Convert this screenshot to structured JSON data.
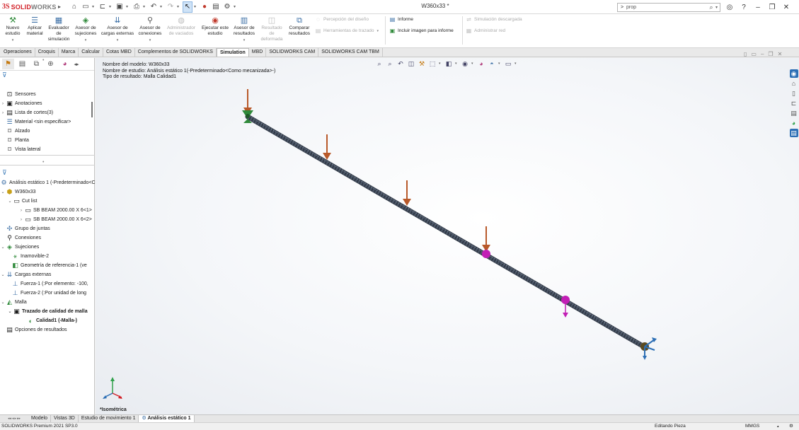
{
  "titlebar": {
    "logo_ds": "3S",
    "logo_solid": "SOLID",
    "logo_works": "WORKS",
    "document_title": "W360x33 *",
    "search_prompt": ">",
    "search_value": "prop"
  },
  "ribbon": {
    "buttons": [
      {
        "label": "Nuevo estudio",
        "icon": "new-study-icon"
      },
      {
        "label": "Aplicar material",
        "icon": "apply-material-icon"
      },
      {
        "label": "Evaluador de simulación",
        "icon": "simulation-evaluator-icon"
      },
      {
        "label": "Asesor de sujeciones",
        "icon": "fixtures-advisor-icon"
      },
      {
        "label": "Asesor de cargas externas",
        "icon": "external-loads-advisor-icon"
      },
      {
        "label": "Asesor de conexiones",
        "icon": "connections-advisor-icon"
      },
      {
        "label": "Administrador de vaciados",
        "icon": "shell-manager-icon"
      },
      {
        "label": "Ejecutar este estudio",
        "icon": "run-study-icon"
      },
      {
        "label": "Asesor de resultados",
        "icon": "results-advisor-icon"
      },
      {
        "label": "Resultado de deformada",
        "icon": "deformed-result-icon"
      },
      {
        "label": "Comparar resultados",
        "icon": "compare-results-icon"
      }
    ],
    "small": {
      "percepcion": "Percepción del diseño",
      "herramientas": "Herramientas de trazado",
      "informe": "Informe",
      "incluir": "Incluir imagen para informe",
      "simulacion_descargada": "Simulación descargada",
      "administrar_red": "Administrar red"
    }
  },
  "cm_tabs": [
    "Operaciones",
    "Croquis",
    "Marca",
    "Calcular",
    "Cotas MBD",
    "Complementos de SOLIDWORKS",
    "Simulation",
    "MBD",
    "SOLIDWORKS CAM",
    "SOLIDWORKS CAM TBM"
  ],
  "cm_active": "Simulation",
  "featuretree": [
    {
      "label": "Sensores",
      "icon": "sensor-icon"
    },
    {
      "label": "Anotaciones",
      "icon": "annotations-icon"
    },
    {
      "label": "Lista de cortes(3)",
      "icon": "cut-list-icon"
    },
    {
      "label": "Material <sin especificar>",
      "icon": "material-icon"
    },
    {
      "label": "Alzado",
      "icon": "plane-icon"
    },
    {
      "label": "Planta",
      "icon": "plane-icon"
    },
    {
      "label": "Vista lateral",
      "icon": "plane-icon"
    }
  ],
  "simtree": [
    {
      "label": "Análisis estático 1 (-Predeterminado<C",
      "icon": "static-study-icon"
    },
    {
      "label": "W360x33",
      "icon": "part-icon"
    },
    {
      "label": "Cut list",
      "icon": "folder-icon"
    },
    {
      "label": "SB BEAM 2000.00 X 6<1>",
      "icon": "beam-folder-icon"
    },
    {
      "label": "SB BEAM 2000.00 X 6<2>",
      "icon": "beam-folder-icon"
    },
    {
      "label": "Grupo de juntas",
      "icon": "joint-group-icon"
    },
    {
      "label": "Conexiones",
      "icon": "connections-icon"
    },
    {
      "label": "Sujeciones",
      "icon": "fixtures-icon"
    },
    {
      "label": "Inamovible-2",
      "icon": "fixed-icon"
    },
    {
      "label": "Geometría de referencia-1 (ve",
      "icon": "ref-geometry-icon"
    },
    {
      "label": "Cargas externas",
      "icon": "external-loads-icon"
    },
    {
      "label": "Fuerza-1 (:Por elemento: -100,",
      "icon": "force-icon"
    },
    {
      "label": "Fuerza-2 (:Por unidad de long",
      "icon": "force-icon"
    },
    {
      "label": "Malla",
      "icon": "mesh-icon"
    },
    {
      "label": "Trazado de calidad de malla",
      "icon": "mesh-plot-folder-icon"
    },
    {
      "label": "Calidad1 (-Malla-)",
      "icon": "mesh-quality-icon"
    },
    {
      "label": "Opciones de resultados",
      "icon": "result-options-icon"
    }
  ],
  "viewport": {
    "model_name": "Nombre del modelo: W360x33",
    "study_name": "Nombre de estudio: Análisis estático 1(-Predeterminado<Como mecanizada>-)",
    "result_type": "Tipo de resultado: Malla Calidad1",
    "view_label": "*Isométrica"
  },
  "bottom_tabs": [
    "Modelo",
    "Vistas 3D",
    "Estudio de movimiento 1",
    "Análisis estático 1"
  ],
  "bottom_active": "Análisis estático 1",
  "status": {
    "product": "SOLIDWORKS Premium 2021 SP3.0",
    "mode": "Editando Pieza",
    "units": "MMGS"
  },
  "colors": {
    "beam": "#3e4a5a",
    "load_arrow": "#b8592a",
    "fixture": "#2f8a3a",
    "connector": "#c21fb5",
    "accent_red": "#d21f26"
  }
}
